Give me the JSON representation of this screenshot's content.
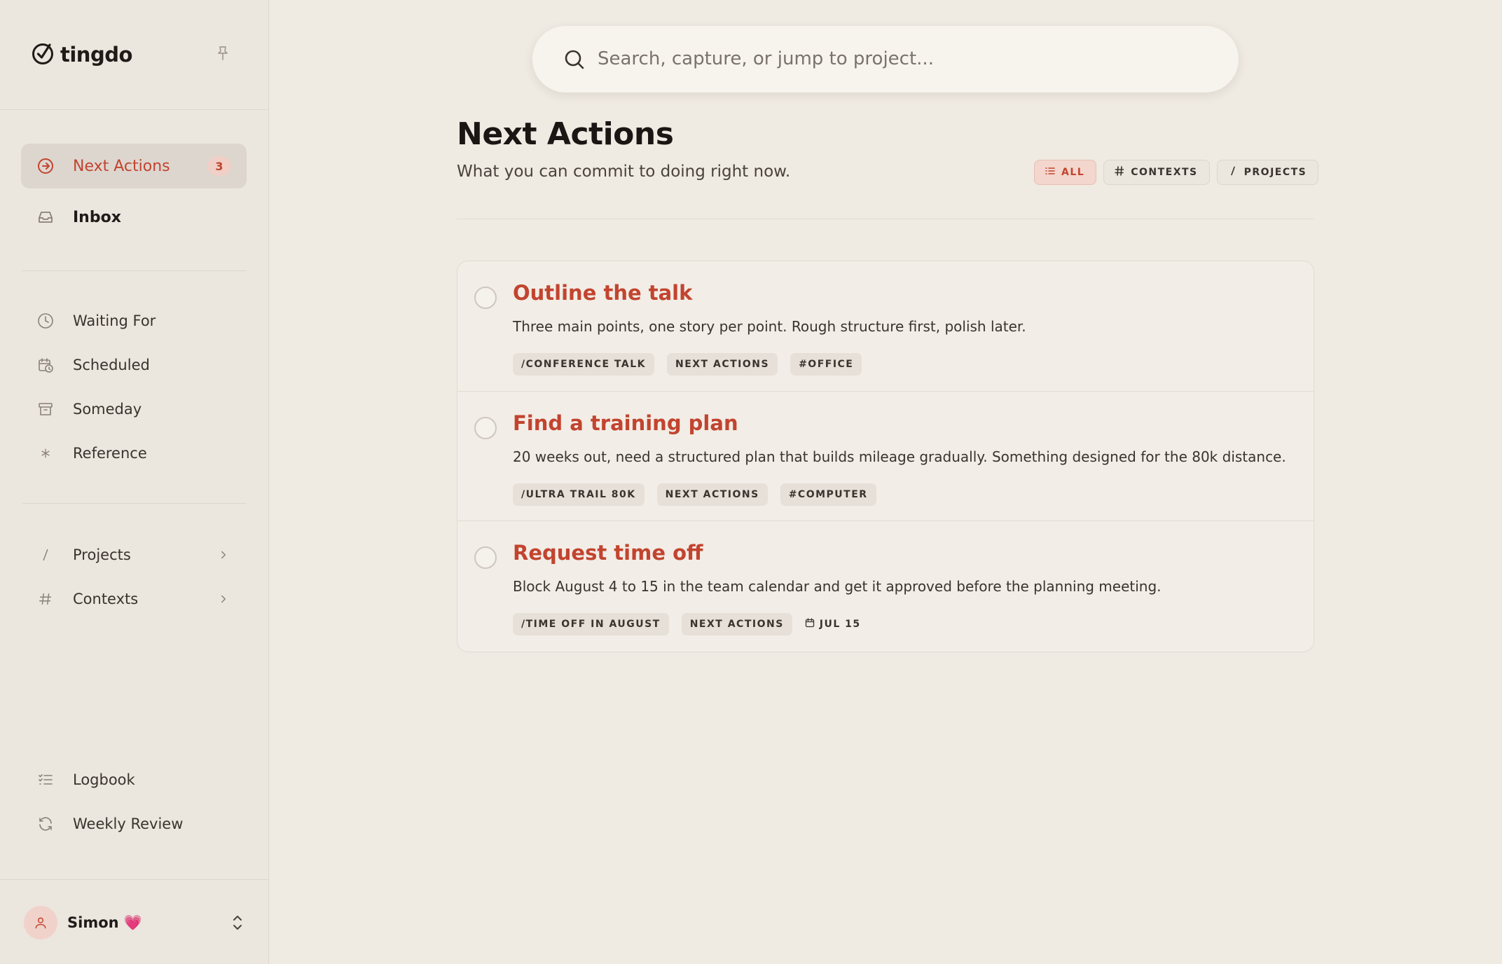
{
  "app": {
    "name": "tingdo"
  },
  "colors": {
    "accent": "#c2442f",
    "background": "#efeae2",
    "sidebar": "#ebe6de"
  },
  "sidebar": {
    "primary": [
      {
        "label": "Next Actions",
        "icon": "arrow-right-circle-icon",
        "badge": "3",
        "active": true
      },
      {
        "label": "Inbox",
        "icon": "inbox-icon"
      }
    ],
    "lists": [
      {
        "label": "Waiting For",
        "icon": "clock-icon"
      },
      {
        "label": "Scheduled",
        "icon": "calendar-clock-icon"
      },
      {
        "label": "Someday",
        "icon": "archive-icon"
      },
      {
        "label": "Reference",
        "icon": "asterisk-icon"
      }
    ],
    "groups": [
      {
        "label": "Projects",
        "icon": "slash-icon"
      },
      {
        "label": "Contexts",
        "icon": "hash-icon"
      }
    ],
    "footer": [
      {
        "label": "Logbook",
        "icon": "checklist-icon"
      },
      {
        "label": "Weekly Review",
        "icon": "refresh-icon"
      }
    ],
    "user": {
      "name": "Simon 💗"
    }
  },
  "search": {
    "placeholder": "Search, capture, or jump to project..."
  },
  "page": {
    "title": "Next Actions",
    "subtitle": "What you can commit to doing right now.",
    "filters": [
      "ALL",
      "CONTEXTS",
      "PROJECTS"
    ]
  },
  "tasks": [
    {
      "title": "Outline the talk",
      "description": "Three main points, one story per point. Rough structure first, polish later.",
      "project": "/CONFERENCE TALK",
      "list": "NEXT ACTIONS",
      "context": "#OFFICE"
    },
    {
      "title": "Find a training plan",
      "description": "20 weeks out, need a structured plan that builds mileage gradually. Something designed for the 80k distance.",
      "project": "/ULTRA TRAIL 80K",
      "list": "NEXT ACTIONS",
      "context": "#COMPUTER"
    },
    {
      "title": "Request time off",
      "description": "Block August 4 to 15 in the team calendar and get it approved before the planning meeting.",
      "project": "/TIME OFF IN AUGUST",
      "list": "NEXT ACTIONS",
      "due": "JUL 15"
    }
  ]
}
